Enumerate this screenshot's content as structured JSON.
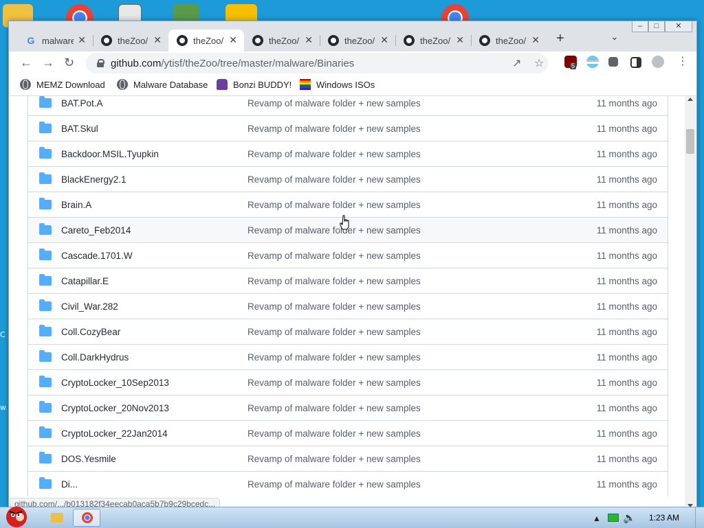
{
  "window": {
    "tabs": [
      {
        "title": "malware",
        "icon": "google-icon",
        "active": false
      },
      {
        "title": "theZoo/",
        "icon": "github-icon",
        "active": false
      },
      {
        "title": "theZoo/",
        "icon": "github-icon",
        "active": true
      },
      {
        "title": "theZoo/",
        "icon": "github-icon",
        "active": false
      },
      {
        "title": "theZoo/",
        "icon": "github-icon",
        "active": false
      },
      {
        "title": "theZoo/",
        "icon": "github-icon",
        "active": false
      },
      {
        "title": "theZoo/",
        "icon": "github-icon",
        "active": false
      }
    ],
    "new_tab_label": "+",
    "tab_close_label": "✕"
  },
  "omnibox": {
    "host": "github.com",
    "path": "/ytisf/theZoo/tree/master/malware/Binaries",
    "extension_badge": "5"
  },
  "bookmarks": [
    {
      "label": "MEMZ Download",
      "icon": "globe-icon"
    },
    {
      "label": "Malware Database",
      "icon": "globe-icon"
    },
    {
      "label": "Bonzi BUDDY!",
      "icon": "bonzi-icon"
    },
    {
      "label": "Windows ISOs",
      "icon": "rainbow-flag-icon"
    }
  ],
  "files": [
    {
      "name": "BAT.Pot.A",
      "commit": "Revamp of malware folder + new samples",
      "age": "11 months ago"
    },
    {
      "name": "BAT.Skul",
      "commit": "Revamp of malware folder + new samples",
      "age": "11 months ago"
    },
    {
      "name": "Backdoor.MSIL.Tyupkin",
      "commit": "Revamp of malware folder + new samples",
      "age": "11 months ago"
    },
    {
      "name": "BlackEnergy2.1",
      "commit": "Revamp of malware folder + new samples",
      "age": "11 months ago"
    },
    {
      "name": "Brain.A",
      "commit": "Revamp of malware folder + new samples",
      "age": "11 months ago"
    },
    {
      "name": "Careto_Feb2014",
      "commit": "Revamp of malware folder + new samples",
      "age": "11 months ago"
    },
    {
      "name": "Cascade.1701.W",
      "commit": "Revamp of malware folder + new samples",
      "age": "11 months ago"
    },
    {
      "name": "Catapillar.E",
      "commit": "Revamp of malware folder + new samples",
      "age": "11 months ago"
    },
    {
      "name": "Civil_War.282",
      "commit": "Revamp of malware folder + new samples",
      "age": "11 months ago"
    },
    {
      "name": "Coll.CozyBear",
      "commit": "Revamp of malware folder + new samples",
      "age": "11 months ago"
    },
    {
      "name": "Coll.DarkHydrus",
      "commit": "Revamp of malware folder + new samples",
      "age": "11 months ago"
    },
    {
      "name": "CryptoLocker_10Sep2013",
      "commit": "Revamp of malware folder + new samples",
      "age": "11 months ago"
    },
    {
      "name": "CryptoLocker_20Nov2013",
      "commit": "Revamp of malware folder + new samples",
      "age": "11 months ago"
    },
    {
      "name": "CryptoLocker_22Jan2014",
      "commit": "Revamp of malware folder + new samples",
      "age": "11 months ago"
    },
    {
      "name": "DOS.Yesmile",
      "commit": "Revamp of malware folder + new samples",
      "age": "11 months ago"
    },
    {
      "name": "Di...",
      "commit": "Revamp of malware folder + new samples",
      "age": "11 months ago"
    }
  ],
  "hover_row_index": 5,
  "status_url": "github.com/.../b013182f34eecab0aca5b7b9c29bcedc...",
  "taskbar": {
    "clock": "1:23 AM"
  },
  "desktop_fragments": [
    "C",
    "w"
  ],
  "colors": {
    "desktop": "#1d9bd8",
    "folder": "#54aeff",
    "text_muted": "#57606a"
  }
}
